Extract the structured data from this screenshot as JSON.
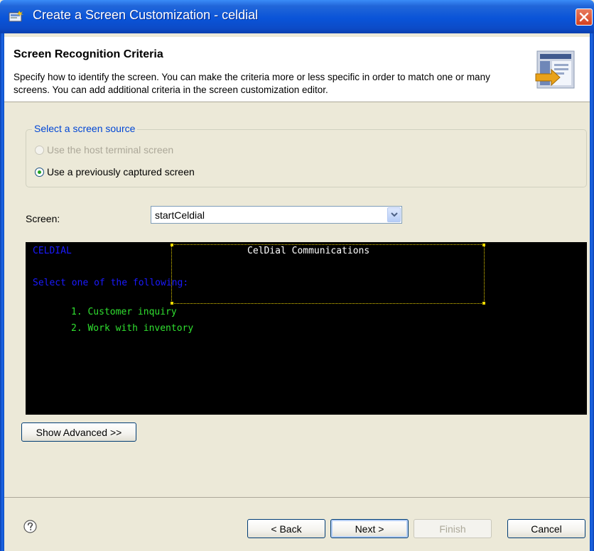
{
  "window": {
    "title": "Create a Screen Customization - celdial",
    "close_icon": "close-icon"
  },
  "header": {
    "title": "Screen Recognition Criteria",
    "description": "Specify how to identify the screen. You can make the criteria more or less specific in order to match one or many screens. You can add additional criteria in the screen customization editor."
  },
  "source_group": {
    "legend": "Select a screen source",
    "options": [
      {
        "label": "Use the host terminal screen",
        "enabled": false,
        "selected": false
      },
      {
        "label": "Use a previously captured screen",
        "enabled": true,
        "selected": true
      }
    ]
  },
  "screen": {
    "label": "Screen:",
    "value": "startCeldial"
  },
  "terminal": {
    "lines": [
      {
        "text": "CELDIAL",
        "color": "#1a1aff"
      },
      {
        "text": "CelDial Communications",
        "color": "#ffffff"
      },
      {
        "text": "Select one of the following:",
        "color": "#1a1aff"
      },
      {
        "text": "1. Customer inquiry",
        "color": "#30e030"
      },
      {
        "text": "2. Work with inventory",
        "color": "#30e030"
      }
    ]
  },
  "buttons": {
    "show_advanced": "Show Advanced >>",
    "back": "< Back",
    "next": "Next >",
    "finish": "Finish",
    "cancel": "Cancel"
  },
  "colors": {
    "accent": "#0046d5",
    "title_bar": "#0a54d8"
  }
}
